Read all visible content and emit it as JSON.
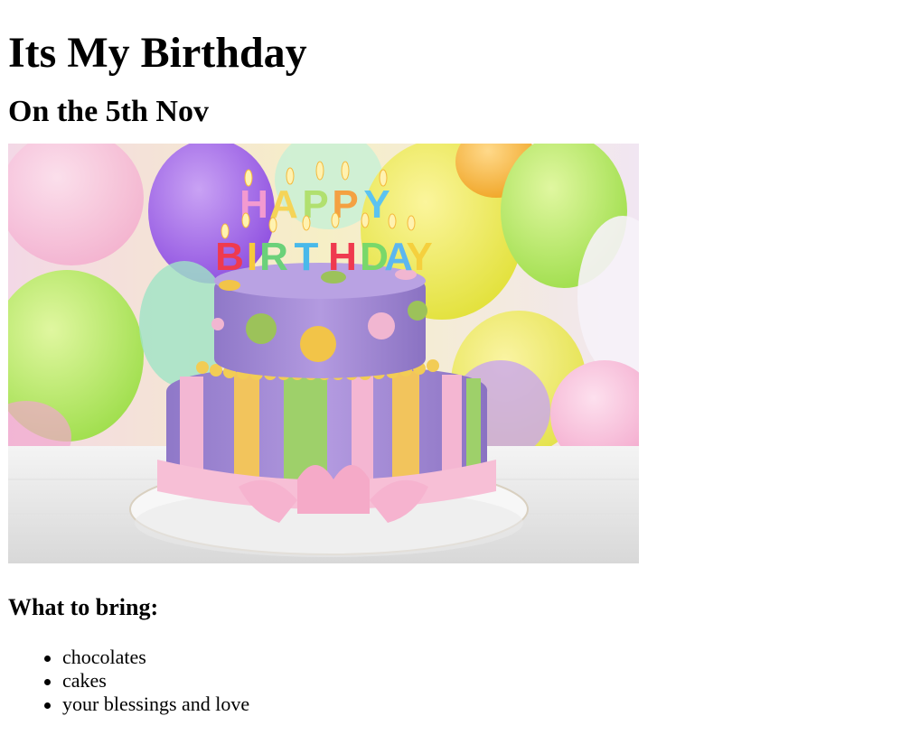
{
  "page": {
    "title": "Its My Birthday",
    "subtitle": "On the 5th Nov",
    "image": {
      "icon": "birthday-cake-photo",
      "cake_topper": "HAPPY BIRTHDAY"
    },
    "bring_heading": "What to bring:",
    "bring_items": [
      "chocolates",
      "cakes",
      "your blessings and love"
    ]
  },
  "colors": {
    "text": "#000000",
    "background": "#ffffff"
  }
}
